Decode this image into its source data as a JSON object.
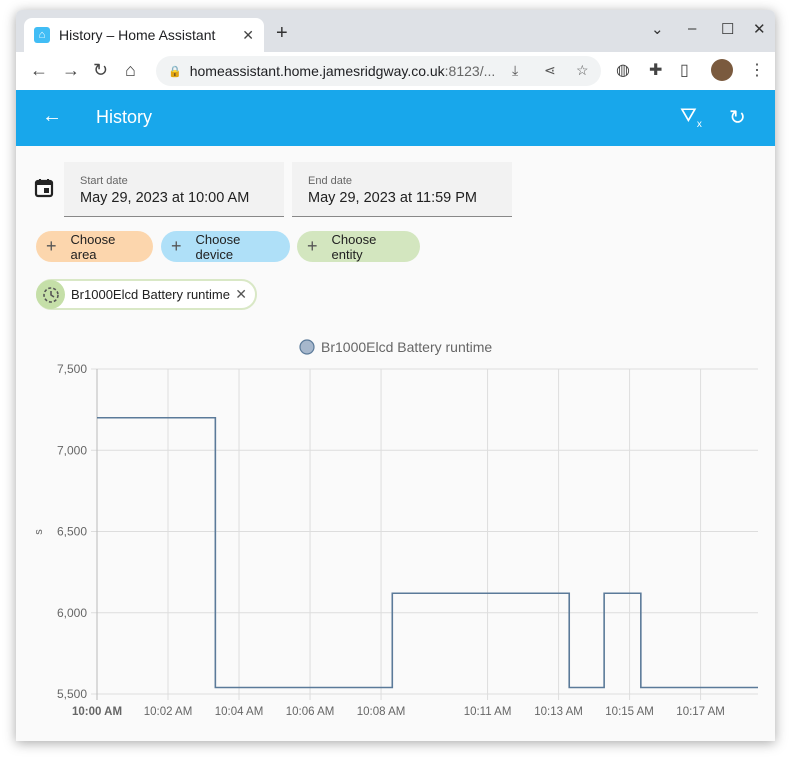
{
  "browser": {
    "tab_title": "History – Home Assistant",
    "url_host": "homeassistant.home.jamesridgway.co.uk",
    "url_rest": ":8123/..."
  },
  "app": {
    "title": "History",
    "accent": "#18a7eb"
  },
  "dates": {
    "start_label": "Start date",
    "start_value": "May 29, 2023 at 10:00 AM",
    "end_label": "End date",
    "end_value": "May 29, 2023 at 11:59 PM"
  },
  "targets": {
    "area": "Choose area",
    "device": "Choose device",
    "entity": "Choose entity",
    "selected_entity": "Br1000Elcd Battery runtime"
  },
  "chart_data": {
    "type": "line",
    "step": true,
    "series": [
      {
        "name": "Br1000Elcd Battery runtime",
        "color": "#5b7a99",
        "points": [
          [
            "10:00:00",
            7200
          ],
          [
            "10:03:20",
            5540
          ],
          [
            "10:08:19",
            6120
          ],
          [
            "10:13:18",
            5540
          ],
          [
            "10:14:17",
            6120
          ],
          [
            "10:15:19",
            5540
          ],
          [
            "10:18:37",
            5540
          ]
        ]
      }
    ],
    "ylabel": "s",
    "ylim": [
      5500,
      7500
    ],
    "yticks": [
      "5,500",
      "6,000",
      "6,500",
      "7,000",
      "7,500"
    ],
    "xticks": [
      "10:00 AM",
      "10:02 AM",
      "10:04 AM",
      "10:06 AM",
      "10:08 AM",
      "10:11 AM",
      "10:13 AM",
      "10:15 AM",
      "10:17 AM"
    ],
    "xrange": [
      "10:00:00",
      "10:18:37"
    ],
    "legend": "top",
    "grid": true
  }
}
